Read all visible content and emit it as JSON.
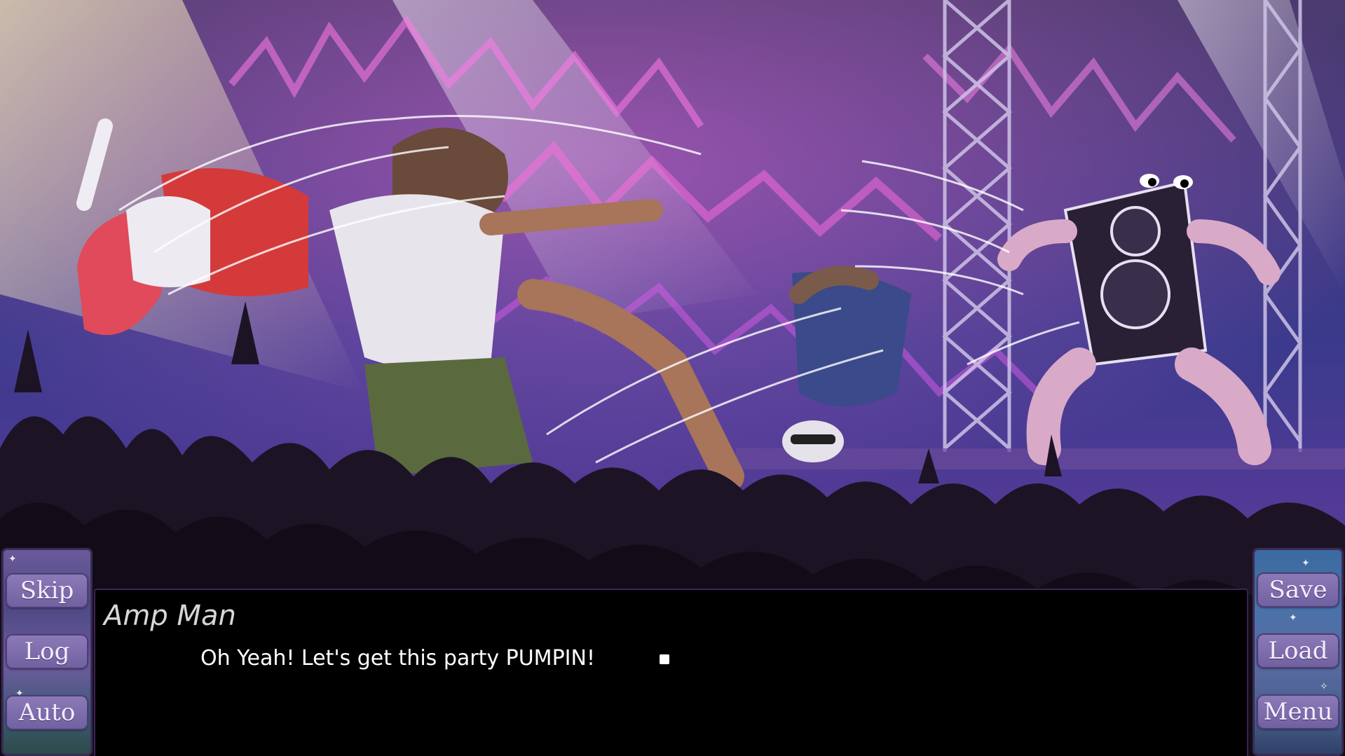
{
  "dialogue": {
    "speaker": "Amp Man",
    "text": "Oh Yeah! Let's get this party PUMPIN!"
  },
  "left_menu": {
    "skip_label": "Skip",
    "log_label": "Log",
    "auto_label": "Auto"
  },
  "right_menu": {
    "save_label": "Save",
    "load_label": "Load",
    "menu_label": "Menu"
  },
  "colors": {
    "dialogue_bg": "#000000",
    "name_color": "#d7d7d7",
    "text_color": "#ffffff",
    "button_fill": "#7d6cad",
    "panel_border": "#3a2a55"
  },
  "scene": {
    "description_icon": "concert-battle-scene"
  }
}
